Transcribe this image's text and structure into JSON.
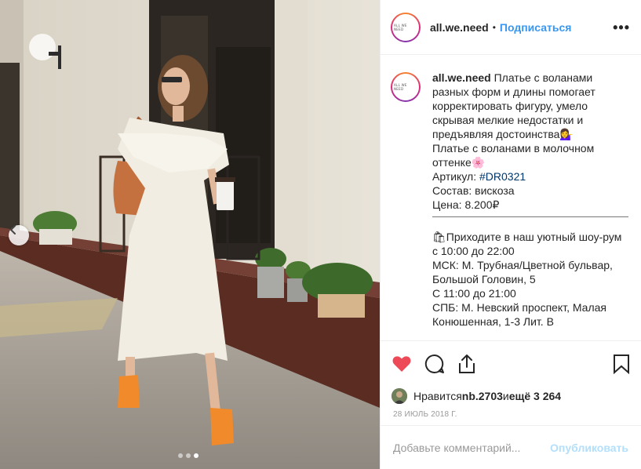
{
  "post": {
    "username": "all.we.need",
    "separator": "•",
    "follow_label": "Подписаться",
    "more_label": "•••",
    "avatar_text": "ALL WE NEED"
  },
  "photo": {
    "carousel_total": 3,
    "carousel_active": 3
  },
  "caption": {
    "username": "all.we.need",
    "line1": " Платье с воланами",
    "line2": "разных форм и длины помогает",
    "line3": "корректировать фигуру, умело",
    "line4": "скрывая мелкие недостатки и",
    "line5": "предъявляя достоинства💁‍♀️",
    "line6": "Платье с воланами в молочном",
    "line7": "оттенке🌸",
    "article_label": "Артикул: ",
    "hashtag": "#DR0321",
    "composition": "Состав: вискоза",
    "price": "Цена: 8.200₽",
    "showroom1": "🛍Приходите в наш уютный шоу-рум",
    "showroom2": "с 10:00 до 22:00",
    "msk1": "МСК: М. Трубная/Цветной бульвар,",
    "msk2": "Большой Головин, 5",
    "hours": "С 11:00 до 21:00",
    "spb1": "СПБ: М. Невский проспект, Малая",
    "spb2": "Конюшенная, 1-3 Лит. В"
  },
  "likes": {
    "prefix": "Нравится ",
    "user": "nb.2703",
    "conj": " и ",
    "more": "ещё 3 264"
  },
  "date": "28 ИЮЛЬ 2018 Г.",
  "comment": {
    "placeholder": "Добавьте комментарий...",
    "post_label": "Опубликовать"
  },
  "colors": {
    "accent": "#3897f0",
    "like": "#ed4956",
    "post_disabled": "#b2dffc",
    "hashtag": "#003569"
  },
  "icons": {
    "like": "heart-icon",
    "comment": "comment-icon",
    "share": "share-icon",
    "save": "bookmark-icon",
    "prev": "chevron-left-icon"
  }
}
